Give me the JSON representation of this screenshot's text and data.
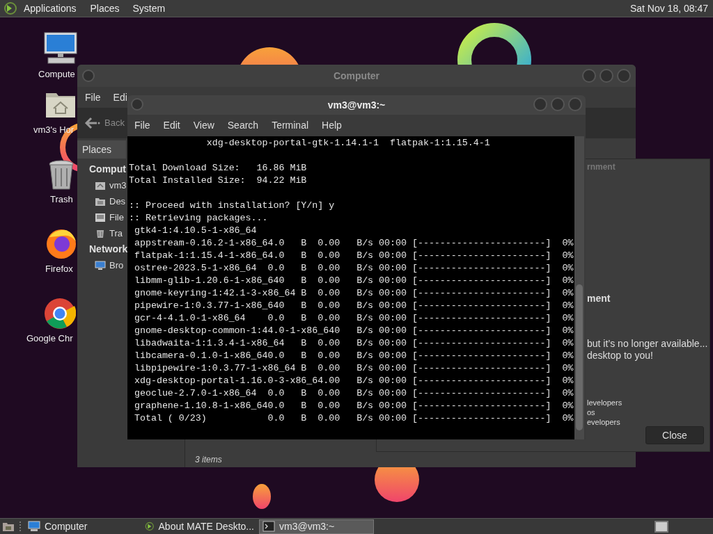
{
  "top_panel": {
    "menus": [
      "Applications",
      "Places",
      "System"
    ],
    "clock": "Sat Nov 18, 08:47"
  },
  "desktop_icons": [
    {
      "kind": "computer",
      "label": "Compute"
    },
    {
      "kind": "home",
      "label": "vm3's Hor"
    },
    {
      "kind": "trash",
      "label": "Trash"
    },
    {
      "kind": "firefox",
      "label": "Firefox"
    },
    {
      "kind": "chrome",
      "label": "Google Chr"
    }
  ],
  "file_manager": {
    "title": "Computer",
    "menu": [
      "File",
      "Edi"
    ],
    "back_button": "Back",
    "sidebar": {
      "header": "Places",
      "sections": [
        {
          "label": "Comput",
          "items": [
            {
              "kind": "home",
              "label": "vm3"
            },
            {
              "kind": "desktop",
              "label": "Des"
            },
            {
              "kind": "drive",
              "label": "File"
            },
            {
              "kind": "trash",
              "label": "Tra"
            }
          ]
        },
        {
          "label": "Network",
          "items": [
            {
              "kind": "network",
              "label": "Bro"
            }
          ]
        }
      ]
    },
    "status": "3 items"
  },
  "about_dialog": {
    "title_fragment": "rnment",
    "heading_fragment": "ment",
    "description": [
      "but it’s no longer available...",
      "desktop to you!"
    ],
    "credits": [
      "levelopers",
      "os",
      "evelopers"
    ],
    "close_button": "Close"
  },
  "terminal": {
    "title": "vm3@vm3:~",
    "menu": [
      "File",
      "Edit",
      "View",
      "Search",
      "Terminal",
      "Help"
    ],
    "blocks": [
      [
        "              xdg-desktop-portal-gtk-1.14.1-1  flatpak-1:1.15.4-1"
      ],
      [
        "Total Download Size:   16.86 MiB",
        "Total Installed Size:  94.22 MiB"
      ],
      [
        ":: Proceed with installation? [Y/n] y",
        ":: Retrieving packages...",
        " gtk4-1:4.10.5-1-x86_64",
        " appstream-0.16.2-1-x86_64.0   B  0.00   B/s 00:00 [-----------------------]  0%",
        " flatpak-1:1.15.4-1-x86_64.0   B  0.00   B/s 00:00 [-----------------------]  0%",
        " ostree-2023.5-1-x86_64  0.0   B  0.00   B/s 00:00 [-----------------------]  0%",
        " libmm-glib-1.20.6-1-x86_640   B  0.00   B/s 00:00 [-----------------------]  0%",
        " gnome-keyring-1:42.1-3-x86_64 B  0.00   B/s 00:00 [-----------------------]  0%",
        " pipewire-1:0.3.77-1-x86_640   B  0.00   B/s 00:00 [-----------------------]  0%",
        " gcr-4-4.1.0-1-x86_64    0.0   B  0.00   B/s 00:00 [-----------------------]  0%",
        " gnome-desktop-common-1:44.0-1-x86_640   B/s 00:00 [-----------------------]  0%",
        " libadwaita-1:1.3.4-1-x86_64   B  0.00   B/s 00:00 [-----------------------]  0%",
        " libcamera-0.1.0-1-x86_640.0   B  0.00   B/s 00:00 [-----------------------]  0%",
        " libpipewire-1:0.3.77-1-x86_64 B  0.00   B/s 00:00 [-----------------------]  0%",
        " xdg-desktop-portal-1.16.0-3-x86_64.00   B/s 00:00 [-----------------------]  0%",
        " geoclue-2.7.0-1-x86_64  0.0   B  0.00   B/s 00:00 [-----------------------]  0%",
        " graphene-1.10.8-1-x86_640.0   B  0.00   B/s 00:00 [-----------------------]  0%",
        " Total ( 0/23)           0.0   B  0.00   B/s 00:00 [-----------------------]  0%"
      ]
    ]
  },
  "taskbar": {
    "tasks": [
      {
        "kind": "file-manager",
        "label": "Computer",
        "selected": false
      },
      {
        "kind": "about",
        "label": "About MATE Deskto...",
        "selected": false
      },
      {
        "kind": "terminal",
        "label": "vm3@vm3:~",
        "selected": true
      }
    ]
  }
}
